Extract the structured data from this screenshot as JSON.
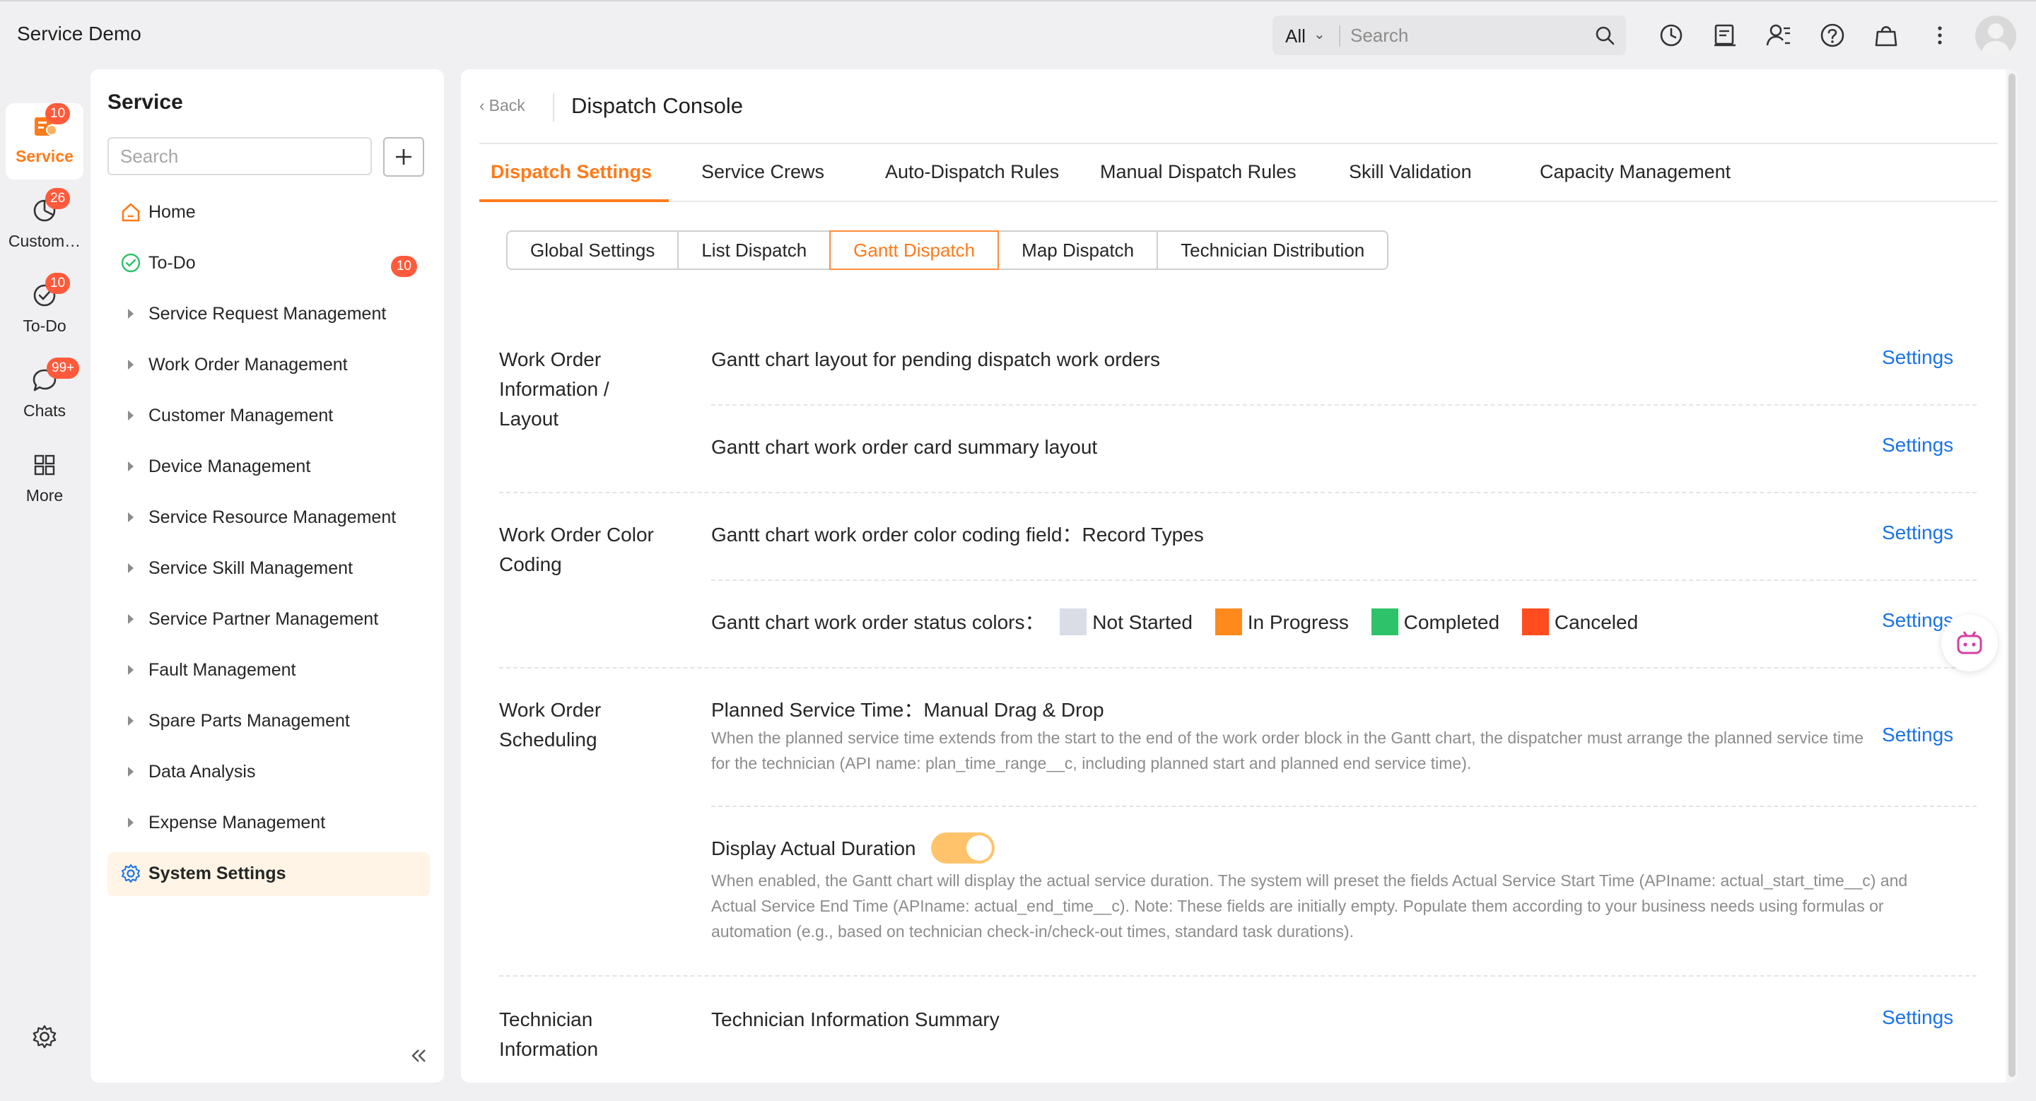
{
  "app": {
    "title": "Service Demo"
  },
  "topbar": {
    "scope": "All",
    "search_placeholder": "Search",
    "icons": [
      "history-icon",
      "notes-icon",
      "user-list-icon",
      "help-icon",
      "store-icon",
      "more-vertical-icon"
    ]
  },
  "rail": {
    "items": [
      {
        "label": "Service",
        "badge": "10",
        "icon": "service-icon",
        "active": true
      },
      {
        "label": "Custom…",
        "badge": "26",
        "icon": "pie-chart-icon"
      },
      {
        "label": "To-Do",
        "badge": "10",
        "icon": "check-circle-icon"
      },
      {
        "label": "Chats",
        "badge": "99+",
        "icon": "chat-icon"
      },
      {
        "label": "More",
        "icon": "grid-icon"
      }
    ],
    "settings_icon": "gear-icon"
  },
  "sidebar": {
    "title": "Service",
    "search_placeholder": "Search",
    "items": [
      {
        "label": "Home"
      },
      {
        "label": "To-Do",
        "badge": "10"
      },
      {
        "label": "Service Request Management"
      },
      {
        "label": "Work Order Management"
      },
      {
        "label": "Customer Management"
      },
      {
        "label": "Device Management"
      },
      {
        "label": "Service Resource Management"
      },
      {
        "label": "Service Skill Management"
      },
      {
        "label": "Service Partner Management"
      },
      {
        "label": "Fault Management"
      },
      {
        "label": "Spare Parts Management"
      },
      {
        "label": "Data Analysis"
      },
      {
        "label": "Expense Management"
      },
      {
        "label": "System Settings"
      }
    ]
  },
  "main": {
    "back_label": "Back",
    "title": "Dispatch Console",
    "tabs": [
      {
        "label": "Dispatch Settings",
        "active": true
      },
      {
        "label": "Service Crews"
      },
      {
        "label": "Auto-Dispatch Rules"
      },
      {
        "label": "Manual Dispatch Rules"
      },
      {
        "label": "Skill Validation"
      },
      {
        "label": "Capacity Management"
      }
    ],
    "subtabs": [
      {
        "label": "Global Settings"
      },
      {
        "label": "List Dispatch"
      },
      {
        "label": "Gantt Dispatch",
        "active": true
      },
      {
        "label": "Map Dispatch"
      },
      {
        "label": "Technician Distribution"
      }
    ],
    "settings_label": "Settings",
    "sections": {
      "layout": {
        "label": "Work Order Information / Layout",
        "row1": "Gantt chart layout for pending dispatch work orders",
        "row2": "Gantt chart work order card summary layout"
      },
      "color": {
        "label": "Work Order Color Coding",
        "row1_prefix": "Gantt chart work order color coding field：",
        "row1_value": "Record Types",
        "row2_prefix": "Gantt chart work order status colors：",
        "statuses": [
          {
            "label": "Not Started",
            "color": "#dadde6"
          },
          {
            "label": "In Progress",
            "color": "#ff8a1c"
          },
          {
            "label": "Completed",
            "color": "#2ec26a"
          },
          {
            "label": "Canceled",
            "color": "#ff4d1f"
          }
        ]
      },
      "scheduling": {
        "label": "Work Order Scheduling",
        "row1_prefix": "Planned Service Time：",
        "row1_value": "Manual Drag & Drop",
        "row1_desc": "When the planned service time extends from the start to the end of the work order block in the Gantt chart, the dispatcher must arrange the planned service time for the technician (API name: plan_time_range__c, including planned start and planned end service time).",
        "row2_title": "Display Actual Duration",
        "row2_toggle_on": true,
        "row2_desc": "When enabled, the Gantt chart will display the actual service duration. The system will preset the fields Actual Service Start Time (APIname: actual_start_time__c) and Actual Service End Time (APIname: actual_end_time__c). Note: These fields are initially empty. Populate them according to your business needs using formulas or automation (e.g., based on technician check-in/check-out times, standard task durations)."
      },
      "technician": {
        "label": "Technician Information",
        "row1": "Technician Information Summary"
      }
    }
  },
  "colors": {
    "accent": "#ff7a1a",
    "link": "#1a73e8",
    "badge": "#ff5a3c",
    "toggle": "#ffc46b"
  }
}
